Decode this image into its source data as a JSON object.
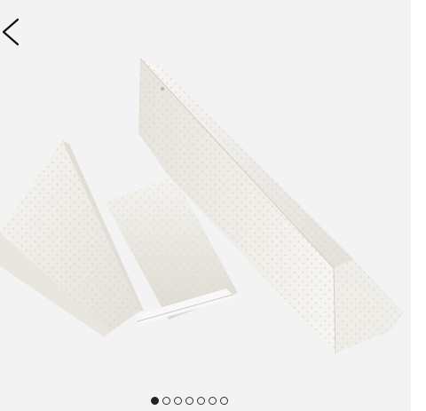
{
  "gallery": {
    "image_subject": "wedge-pillow-product-photo",
    "back_icon": "chevron-left-icon",
    "pagination": {
      "total": 7,
      "active_index": 0
    }
  },
  "colors": {
    "background": "#f3f3f3",
    "pillow": "#ebe9e3",
    "dot_active": "#222222",
    "dot_inactive": "#333333"
  }
}
